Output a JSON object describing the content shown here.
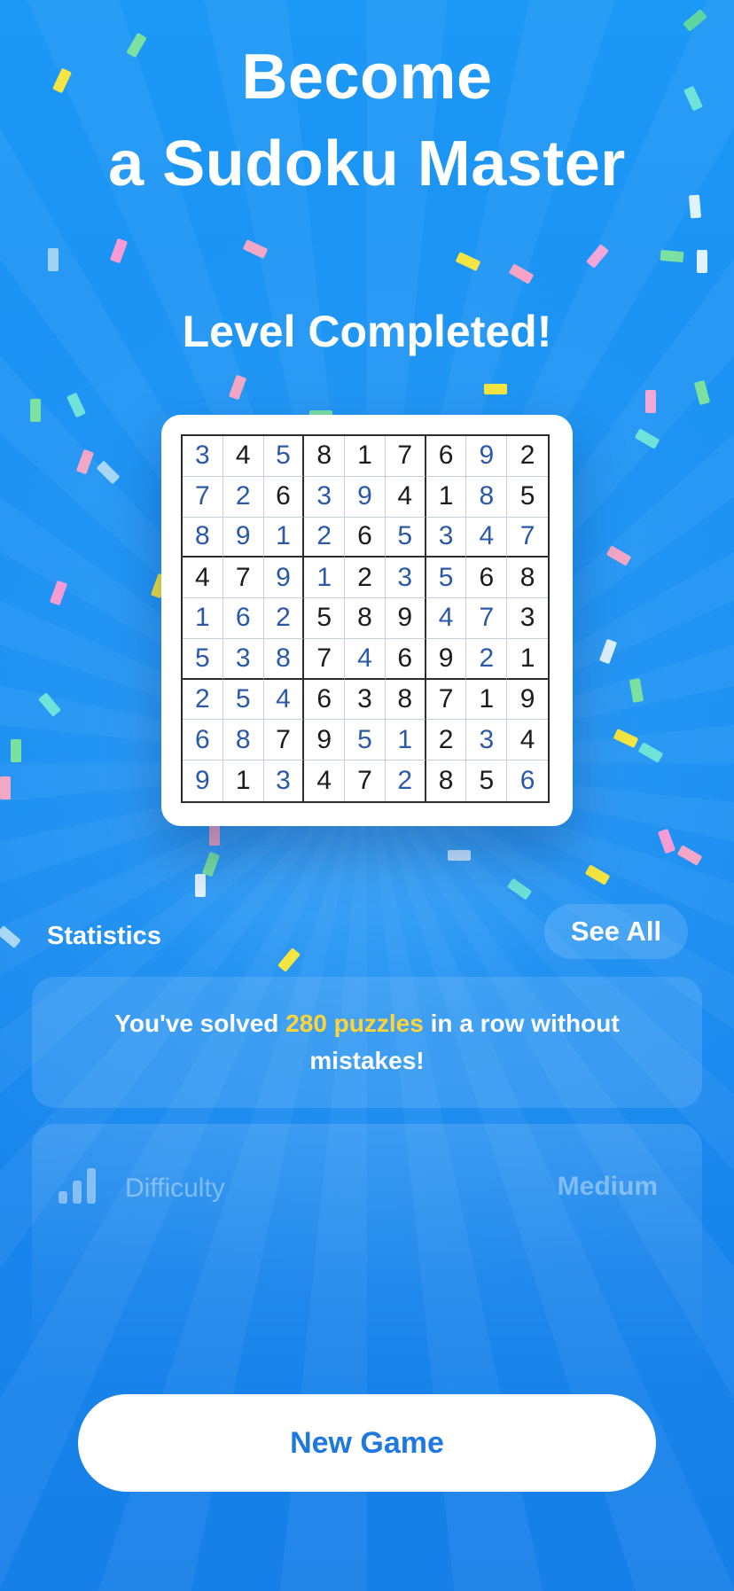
{
  "header": {
    "title_line1": "Become",
    "title_line2": "a Sudoku Master",
    "level_message": "Level Completed!"
  },
  "board": {
    "rows": [
      [
        3,
        4,
        5,
        8,
        1,
        7,
        6,
        9,
        2
      ],
      [
        7,
        2,
        6,
        3,
        9,
        4,
        1,
        8,
        5
      ],
      [
        8,
        9,
        1,
        2,
        6,
        5,
        3,
        4,
        7
      ],
      [
        4,
        7,
        9,
        1,
        2,
        3,
        5,
        6,
        8
      ],
      [
        1,
        6,
        2,
        5,
        8,
        9,
        4,
        7,
        3
      ],
      [
        5,
        3,
        8,
        7,
        4,
        6,
        9,
        2,
        1
      ],
      [
        2,
        5,
        4,
        6,
        3,
        8,
        7,
        1,
        9
      ],
      [
        6,
        8,
        7,
        9,
        5,
        1,
        2,
        3,
        4
      ],
      [
        9,
        1,
        3,
        4,
        7,
        2,
        8,
        5,
        6
      ]
    ],
    "user_filled": [
      [
        1,
        0,
        1,
        0,
        0,
        0,
        0,
        1,
        0
      ],
      [
        1,
        1,
        0,
        1,
        1,
        0,
        0,
        1,
        0
      ],
      [
        1,
        1,
        1,
        1,
        0,
        1,
        1,
        1,
        1
      ],
      [
        0,
        0,
        1,
        1,
        0,
        1,
        1,
        0,
        0
      ],
      [
        1,
        1,
        1,
        0,
        0,
        0,
        1,
        1,
        0
      ],
      [
        1,
        1,
        1,
        0,
        1,
        0,
        0,
        1,
        0
      ],
      [
        1,
        1,
        1,
        0,
        0,
        0,
        0,
        0,
        0
      ],
      [
        1,
        1,
        0,
        0,
        1,
        1,
        0,
        1,
        0
      ],
      [
        1,
        0,
        1,
        0,
        0,
        1,
        0,
        0,
        1
      ]
    ],
    "given_color": "#1c1c1e",
    "user_color": "#2b59a8"
  },
  "statistics": {
    "title": "Statistics",
    "see_all_label": "See All",
    "streak_prefix": "You've solved ",
    "streak_highlight": "280 puzzles",
    "streak_suffix": " in a row without mistakes!",
    "highlight_color": "#ffd43a"
  },
  "difficulty": {
    "icon": "signal-bars-icon",
    "label": "Difficulty",
    "value": "Medium"
  },
  "actions": {
    "new_game_label": "New Game"
  },
  "colors": {
    "background": "#1a8ff0",
    "button_text": "#1f78e0"
  }
}
